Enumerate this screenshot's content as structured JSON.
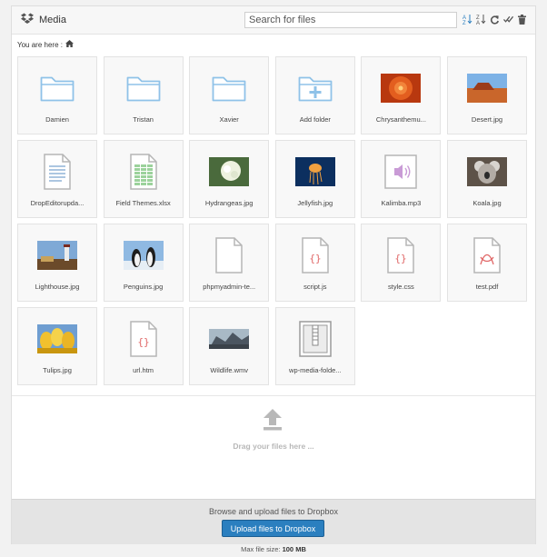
{
  "header": {
    "title": "Media",
    "logo_icon": "dropbox-icon",
    "search_placeholder": "Search for files",
    "tools": [
      "sort-az-icon",
      "sort-za-icon",
      "refresh-icon",
      "select-all-icon",
      "trash-icon"
    ]
  },
  "breadcrumb": {
    "label": "You are here :",
    "icon": "home-icon"
  },
  "colors": {
    "folder": "#8fc2e8",
    "accent": "#2b7fbf",
    "code": "#e06666"
  },
  "files": [
    {
      "name": "Damien",
      "kind": "folder"
    },
    {
      "name": "Tristan",
      "kind": "folder"
    },
    {
      "name": "Xavier",
      "kind": "folder"
    },
    {
      "name": "Add folder",
      "kind": "add-folder"
    },
    {
      "name": "Chrysanthemu...",
      "kind": "image",
      "photo": "chrysanthemum"
    },
    {
      "name": "Desert.jpg",
      "kind": "image",
      "photo": "desert"
    },
    {
      "name": "DropEditorupda...",
      "kind": "doc"
    },
    {
      "name": "Field Themes.xlsx",
      "kind": "sheet"
    },
    {
      "name": "Hydrangeas.jpg",
      "kind": "image",
      "photo": "hydrangeas"
    },
    {
      "name": "Jellyfish.jpg",
      "kind": "image",
      "photo": "jellyfish"
    },
    {
      "name": "Kalimba.mp3",
      "kind": "audio"
    },
    {
      "name": "Koala.jpg",
      "kind": "image",
      "photo": "koala"
    },
    {
      "name": "Lighthouse.jpg",
      "kind": "image",
      "photo": "lighthouse"
    },
    {
      "name": "Penguins.jpg",
      "kind": "image",
      "photo": "penguins"
    },
    {
      "name": "phpmyadmin-te...",
      "kind": "blank"
    },
    {
      "name": "script.js",
      "kind": "code"
    },
    {
      "name": "style.css",
      "kind": "code"
    },
    {
      "name": "test.pdf",
      "kind": "pdf"
    },
    {
      "name": "Tulips.jpg",
      "kind": "image",
      "photo": "tulips"
    },
    {
      "name": "url.htm",
      "kind": "code"
    },
    {
      "name": "Wildlife.wmv",
      "kind": "video",
      "photo": "wildlife"
    },
    {
      "name": "wp-media-folde...",
      "kind": "archive"
    }
  ],
  "dropzone": {
    "text": "Drag your files here ...",
    "icon": "upload-arrow-icon"
  },
  "upload": {
    "text": "Browse and upload files to Dropbox",
    "button": "Upload files to Dropbox"
  },
  "footer": {
    "label": "Max file size:",
    "value": "100 MB"
  }
}
